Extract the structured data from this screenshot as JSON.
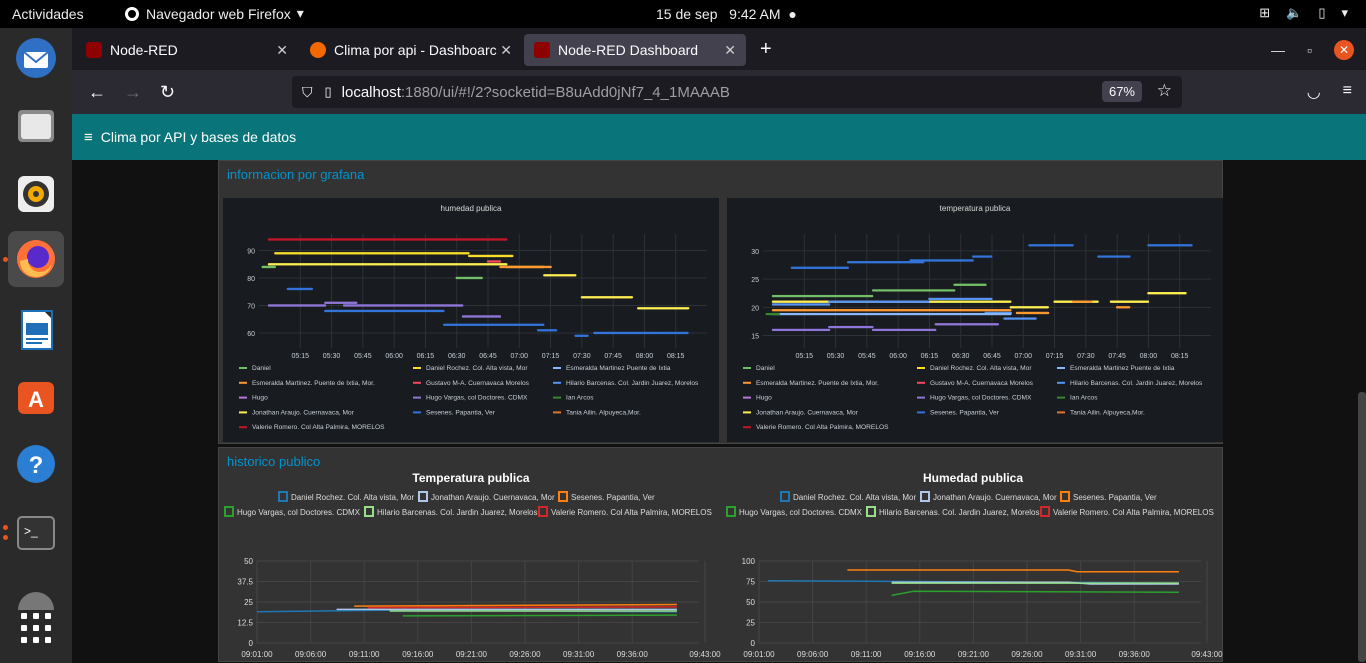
{
  "topbar": {
    "activities": "Actividades",
    "app_name": "Navegador web Firefox",
    "date": "15 de sep",
    "time": "9:42 AM"
  },
  "tabs": [
    {
      "label": "Node-RED"
    },
    {
      "label": "Clima por api - Dashboarc"
    },
    {
      "label": "Node-RED Dashboard"
    }
  ],
  "url": {
    "host": "localhost",
    "path": ":1880/ui/#!/2?socketid=B8uAdd0jNf7_4_1MAAAB",
    "zoom": "67%"
  },
  "dashboard": {
    "title": "Clima por API y bases de datos"
  },
  "groups": {
    "grafana": {
      "title": "informacion por grafana"
    },
    "historico": {
      "title": "historico publico"
    }
  },
  "grafana_legend": [
    {
      "name": "Daniel",
      "color": "#73bf69"
    },
    {
      "name": "Daniel Rochez. Col. Alta vista, Mor",
      "color": "#fade2a"
    },
    {
      "name": "Esmeralda Martinez Puente de Ixtia",
      "color": "#8ab8ff"
    },
    {
      "name": "Esmeralda Martinez. Puente de Ixtia, Mor.",
      "color": "#ff9830"
    },
    {
      "name": "Gustavo M-A. Cuernavaca Morelos",
      "color": "#f2495c"
    },
    {
      "name": "Hilario Barcenas. Col. Jardin Juarez, Morelos",
      "color": "#5794f2"
    },
    {
      "name": "Hugo",
      "color": "#b877d9"
    },
    {
      "name": "Hugo Vargas, col Doctores. CDMX",
      "color": "#8f77d9"
    },
    {
      "name": "Ian Arcos",
      "color": "#37872d"
    },
    {
      "name": "Jonathan Araujo. Cuernavaca, Mor",
      "color": "#ffee52"
    },
    {
      "name": "Sesenes. Papantia, Ver",
      "color": "#3274d9"
    },
    {
      "name": "Tania Ailin. Alpuyeca,Mor.",
      "color": "#e0752d"
    },
    {
      "name": "Valerie Romero. Col Alta Palmira, MORELOS",
      "color": "#c4162a"
    }
  ],
  "hist_legend": [
    {
      "name": "Daniel Rochez. Col. Alta vista, Mor",
      "color": "#1f77b4"
    },
    {
      "name": "Jonathan Araujo. Cuernavaca, Mor",
      "color": "#aec7e8"
    },
    {
      "name": "Sesenes. Papantia, Ver",
      "color": "#ff7f0e"
    },
    {
      "name": "Hugo Vargas, col Doctores. CDMX",
      "color": "#2ca02c"
    },
    {
      "name": "Hilario Barcenas. Col. Jardin Juarez, Morelos",
      "color": "#98df8a"
    },
    {
      "name": "Valerie Romero. Col Alta Palmira, MORELOS",
      "color": "#d62728"
    }
  ],
  "chart_data": [
    {
      "type": "scatter",
      "title": "humedad publica",
      "x_ticks": [
        "05:15",
        "05:30",
        "05:45",
        "06:00",
        "06:15",
        "06:30",
        "06:45",
        "07:00",
        "07:15",
        "07:30",
        "07:45",
        "08:00",
        "08:15"
      ],
      "y_ticks": [
        60,
        70,
        80,
        90
      ],
      "ylim": [
        56,
        96
      ],
      "series": [
        {
          "name": "Valerie Romero. Col Alta Palmira, MORELOS",
          "color": "#c4162a",
          "segments": [
            [
              5.0,
              6.9,
              94
            ]
          ]
        },
        {
          "name": "Daniel Rochez. Col. Alta vista, Mor",
          "color": "#fade2a",
          "segments": [
            [
              5.05,
              6.6,
              89
            ],
            [
              6.6,
              6.95,
              88
            ]
          ]
        },
        {
          "name": "Jonathan Araujo. Cuernavaca, Mor",
          "color": "#ffee52",
          "segments": [
            [
              5.0,
              6.9,
              85
            ],
            [
              6.9,
              7.2,
              84
            ],
            [
              7.2,
              7.45,
              81
            ],
            [
              7.5,
              7.9,
              73
            ],
            [
              7.95,
              8.35,
              69
            ]
          ]
        },
        {
          "name": "Esmeralda Martinez. Puente de Ixtia, Mor.",
          "color": "#ff9830",
          "segments": [
            [
              6.85,
              7.25,
              84
            ]
          ]
        },
        {
          "name": "Daniel",
          "color": "#73bf69",
          "segments": [
            [
              4.95,
              5.05,
              84
            ],
            [
              6.5,
              6.7,
              80
            ]
          ]
        },
        {
          "name": "Sesenes. Papantia, Ver",
          "color": "#3274d9",
          "segments": [
            [
              5.15,
              5.35,
              76
            ],
            [
              5.45,
              6.4,
              68
            ],
            [
              6.4,
              7.2,
              63
            ],
            [
              7.15,
              7.3,
              61
            ],
            [
              7.45,
              7.55,
              59
            ],
            [
              7.6,
              8.35,
              60
            ]
          ]
        },
        {
          "name": "Hugo Vargas, col Doctores. CDMX",
          "color": "#8f77d9",
          "segments": [
            [
              5.0,
              5.45,
              70
            ],
            [
              5.45,
              5.7,
              71
            ],
            [
              5.6,
              6.55,
              70
            ],
            [
              6.55,
              6.85,
              66
            ]
          ]
        },
        {
          "name": "Gustavo M-A. Cuernavaca Morelos",
          "color": "#f2495c",
          "segments": [
            [
              6.75,
              6.85,
              86
            ]
          ]
        }
      ]
    },
    {
      "type": "scatter",
      "title": "temperatura publica",
      "x_ticks": [
        "05:15",
        "05:30",
        "05:45",
        "06:00",
        "06:15",
        "06:30",
        "06:45",
        "07:00",
        "07:15",
        "07:30",
        "07:45",
        "08:00",
        "08:15"
      ],
      "y_ticks": [
        15,
        20,
        25,
        30
      ],
      "ylim": [
        13.5,
        33
      ],
      "series": [
        {
          "name": "Sesenes. Papantia, Ver",
          "color": "#3274d9",
          "segments": [
            [
              5.15,
              5.6,
              27
            ],
            [
              5.6,
              6.2,
              28
            ],
            [
              6.1,
              6.6,
              28.3
            ],
            [
              6.6,
              6.75,
              29
            ],
            [
              7.05,
              7.4,
              31
            ],
            [
              7.6,
              7.85,
              29
            ],
            [
              8.0,
              8.35,
              31
            ]
          ]
        },
        {
          "name": "Daniel",
          "color": "#73bf69",
          "segments": [
            [
              5.0,
              5.8,
              22
            ],
            [
              5.8,
              6.45,
              23
            ],
            [
              6.45,
              6.7,
              24
            ]
          ]
        },
        {
          "name": "Jonathan Araujo. Cuernavaca, Mor",
          "color": "#ffee52",
          "segments": [
            [
              5.0,
              6.9,
              21
            ],
            [
              6.9,
              7.2,
              20
            ],
            [
              7.25,
              7.6,
              21
            ],
            [
              7.7,
              8.0,
              21
            ],
            [
              8.0,
              8.3,
              22.5
            ]
          ]
        },
        {
          "name": "Esmeralda Martinez. Puente de Ixtia, Mor.",
          "color": "#ff9830",
          "segments": [
            [
              5.0,
              6.9,
              19.5
            ],
            [
              6.95,
              7.2,
              19
            ],
            [
              7.4,
              7.55,
              21
            ],
            [
              7.75,
              7.85,
              20
            ]
          ]
        },
        {
          "name": "Hilario Barcenas. Col. Jardin Juarez, Morelos",
          "color": "#5794f2",
          "segments": [
            [
              5.0,
              5.45,
              20.5
            ],
            [
              5.45,
              6.25,
              21
            ],
            [
              6.25,
              6.75,
              21.5
            ],
            [
              6.7,
              6.9,
              19
            ],
            [
              6.85,
              7.1,
              18
            ]
          ]
        },
        {
          "name": "Hugo Vargas, col Doctores. CDMX",
          "color": "#8f77d9",
          "segments": [
            [
              5.0,
              5.45,
              16
            ],
            [
              5.45,
              5.8,
              16.5
            ],
            [
              5.8,
              6.3,
              16
            ],
            [
              6.3,
              6.8,
              17
            ]
          ]
        },
        {
          "name": "Esmeralda Martinez Puente de Ixtia",
          "color": "#8ab8ff",
          "segments": [
            [
              5.0,
              6.9,
              18.8
            ]
          ]
        },
        {
          "name": "Ian Arcos",
          "color": "#37872d",
          "segments": [
            [
              4.95,
              5.05,
              18.8
            ]
          ]
        }
      ]
    },
    {
      "type": "line",
      "title": "Temperatura publica",
      "x_ticks": [
        "09:01:00",
        "09:06:00",
        "09:11:00",
        "09:16:00",
        "09:21:00",
        "09:26:00",
        "09:31:00",
        "09:36:00",
        "09:43:00"
      ],
      "y_ticks": [
        0,
        12.5,
        25,
        37.5,
        50
      ],
      "ylim": [
        0,
        50
      ],
      "series": [
        {
          "name": "Daniel Rochez. Col. Alta vista, Mor",
          "color": "#1f77b4",
          "points": [
            [
              0,
              19
            ],
            [
              0.3,
              20
            ],
            [
              0.95,
              19
            ]
          ]
        },
        {
          "name": "Jonathan Araujo. Cuernavaca, Mor",
          "color": "#aec7e8",
          "points": [
            [
              0.18,
              20.5
            ],
            [
              0.95,
              20.5
            ]
          ]
        },
        {
          "name": "Sesenes. Papantia, Ver",
          "color": "#ff7f0e",
          "points": [
            [
              0.22,
              22.5
            ],
            [
              0.95,
              23.5
            ]
          ]
        },
        {
          "name": "Hugo Vargas, col Doctores. CDMX",
          "color": "#2ca02c",
          "points": [
            [
              0.33,
              16.5
            ],
            [
              0.95,
              17
            ]
          ]
        },
        {
          "name": "Hilario Barcenas. Col. Jardin Juarez, Morelos",
          "color": "#98df8a",
          "points": [
            [
              0.3,
              19.5
            ],
            [
              0.95,
              19.5
            ]
          ]
        },
        {
          "name": "Valerie Romero. Col Alta Palmira, MORELOS",
          "color": "#d62728",
          "points": [
            [
              0.25,
              21.5
            ],
            [
              0.95,
              22
            ]
          ]
        }
      ]
    },
    {
      "type": "line",
      "title": "Humedad publica",
      "x_ticks": [
        "09:01:00",
        "09:06:00",
        "09:11:00",
        "09:16:00",
        "09:21:00",
        "09:26:00",
        "09:31:00",
        "09:36:00",
        "09:43:00"
      ],
      "y_ticks": [
        0,
        25,
        50,
        75,
        100
      ],
      "ylim": [
        0,
        100
      ],
      "series": [
        {
          "name": "Daniel Rochez. Col. Alta vista, Mor",
          "color": "#1f77b4",
          "points": [
            [
              0.02,
              76
            ],
            [
              0.95,
              73
            ]
          ]
        },
        {
          "name": "Jonathan Araujo. Cuernavaca, Mor",
          "color": "#aec7e8",
          "points": [
            [
              0.3,
              74
            ],
            [
              0.7,
              74
            ],
            [
              0.75,
              72
            ],
            [
              0.95,
              72
            ]
          ]
        },
        {
          "name": "Sesenes. Papantia, Ver",
          "color": "#ff7f0e",
          "points": [
            [
              0.2,
              89
            ],
            [
              0.7,
              89
            ],
            [
              0.72,
              87
            ],
            [
              0.95,
              87
            ]
          ]
        },
        {
          "name": "Hugo Vargas, col Doctores. CDMX",
          "color": "#2ca02c",
          "points": [
            [
              0.3,
              58
            ],
            [
              0.35,
              63
            ],
            [
              0.95,
              62
            ]
          ]
        },
        {
          "name": "Hilario Barcenas. Col. Jardin Juarez, Morelos",
          "color": "#98df8a",
          "points": [
            [
              0.3,
              73
            ],
            [
              0.95,
              73
            ]
          ]
        },
        {
          "name": "Valerie Romero. Col Alta Palmira, MORELOS",
          "color": "#d62728",
          "points": []
        }
      ]
    }
  ]
}
